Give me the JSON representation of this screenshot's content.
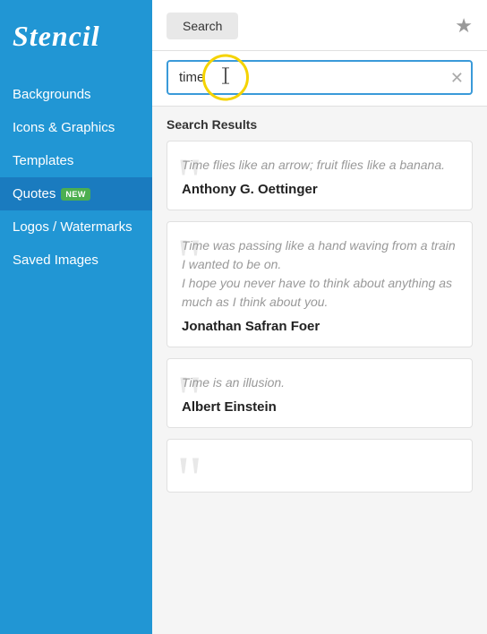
{
  "sidebar": {
    "logo": "Stencil",
    "items": [
      {
        "id": "backgrounds",
        "label": "Backgrounds",
        "active": false
      },
      {
        "id": "icons-graphics",
        "label": "Icons & Graphics",
        "active": false
      },
      {
        "id": "templates",
        "label": "Templates",
        "active": false
      },
      {
        "id": "quotes",
        "label": "Quotes",
        "active": true,
        "badge": "NEW"
      },
      {
        "id": "logos-watermarks",
        "label": "Logos / Watermarks",
        "active": false
      },
      {
        "id": "saved-images",
        "label": "Saved Images",
        "active": false
      }
    ]
  },
  "topbar": {
    "search_tab_label": "Search",
    "star_icon": "★"
  },
  "search": {
    "value": "time",
    "placeholder": "Search"
  },
  "results": {
    "label": "Search Results",
    "quotes": [
      {
        "text": "Time flies like an arrow; fruit flies like a banana.",
        "author": "Anthony G. Oettinger"
      },
      {
        "text": "Time was passing like a hand waving from a train I wanted to be on.\nI hope you never have to think about anything as much as I think about you.",
        "author": "Jonathan Safran Foer"
      },
      {
        "text": "Time is an illusion.",
        "author": "Albert Einstein"
      },
      {
        "text": "",
        "author": ""
      }
    ]
  }
}
